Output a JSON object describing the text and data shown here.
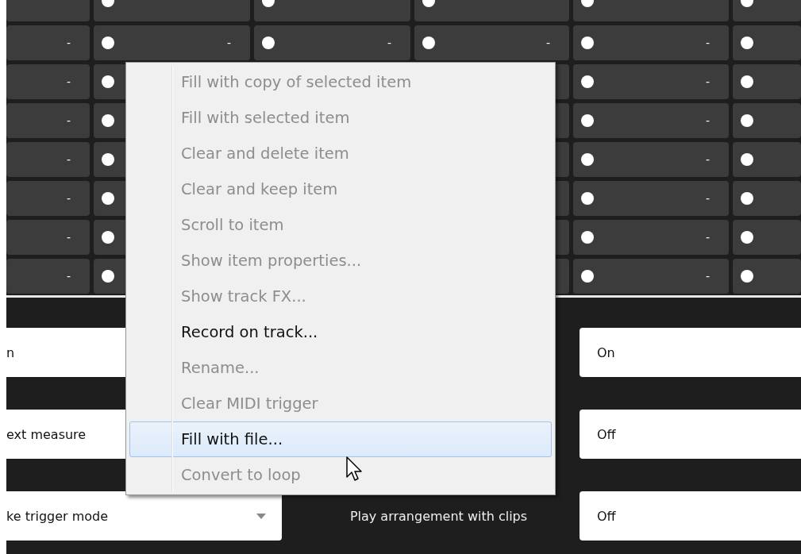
{
  "grid": {
    "rows": [
      {
        "partial": true,
        "cells": [
          {
            "dot": false
          },
          {
            "dot": true
          },
          {
            "dot": true
          },
          {
            "dot": true
          },
          {
            "dot": true
          },
          {
            "dot": true
          }
        ]
      },
      {
        "partial": false,
        "cells": [
          {
            "dot": false,
            "value": "-"
          },
          {
            "dot": true,
            "value": "-"
          },
          {
            "dot": true,
            "value": "-"
          },
          {
            "dot": true,
            "value": "-"
          },
          {
            "dot": true,
            "value": "-"
          },
          {
            "dot": true
          }
        ]
      },
      {
        "partial": false,
        "cells": [
          {
            "dot": false,
            "value": "-"
          },
          {
            "dot": true
          },
          null,
          {},
          {
            "dot": true,
            "value": "-"
          },
          {
            "dot": true
          }
        ]
      },
      {
        "partial": false,
        "cells": [
          {
            "dot": false,
            "value": "-"
          },
          {
            "dot": true
          },
          null,
          {},
          {
            "dot": true,
            "value": "-"
          },
          {
            "dot": true
          }
        ]
      },
      {
        "partial": false,
        "cells": [
          {
            "dot": false,
            "value": "-"
          },
          {
            "dot": true
          },
          null,
          {},
          {
            "dot": true,
            "value": "-"
          },
          {
            "dot": true
          }
        ]
      },
      {
        "partial": false,
        "cells": [
          {
            "dot": false,
            "value": "-"
          },
          {
            "dot": true
          },
          null,
          {},
          {
            "dot": true,
            "value": "-"
          },
          {
            "dot": true
          }
        ]
      },
      {
        "partial": false,
        "cells": [
          {
            "dot": false,
            "value": "-"
          },
          {
            "dot": true
          },
          null,
          {},
          {
            "dot": true,
            "value": "-"
          },
          {
            "dot": true
          }
        ]
      },
      {
        "partial": false,
        "cells": [
          {
            "dot": false,
            "value": "-"
          },
          {
            "dot": true
          },
          null,
          {},
          {
            "dot": true,
            "value": "-"
          },
          {
            "dot": true
          }
        ]
      }
    ]
  },
  "settings": [
    {
      "left_value": "n",
      "right_value": "On"
    },
    {
      "left_value": "ext measure",
      "right_value": "Off"
    },
    {
      "left_value": "ke trigger mode",
      "dropdown": true,
      "label": "Play arrangement with clips",
      "right_value": "Off"
    }
  ],
  "context_menu": {
    "items": [
      {
        "label": "Fill with copy of selected item",
        "disabled": true,
        "selected": false
      },
      {
        "label": "Fill with selected item",
        "disabled": true,
        "selected": false
      },
      {
        "label": "Clear and delete item",
        "disabled": true,
        "selected": false
      },
      {
        "label": "Clear and keep item",
        "disabled": true,
        "selected": false
      },
      {
        "label": "Scroll to item",
        "disabled": true,
        "selected": false
      },
      {
        "label": "Show item properties...",
        "disabled": true,
        "selected": false
      },
      {
        "label": "Show track FX...",
        "disabled": true,
        "selected": false
      },
      {
        "label": "Record on track...",
        "disabled": false,
        "selected": false
      },
      {
        "label": "Rename...",
        "disabled": true,
        "selected": false
      },
      {
        "label": "Clear MIDI trigger",
        "disabled": true,
        "selected": false
      },
      {
        "label": "Fill with file...",
        "disabled": false,
        "selected": true
      },
      {
        "label": "Convert to loop",
        "disabled": true,
        "selected": false
      }
    ]
  }
}
